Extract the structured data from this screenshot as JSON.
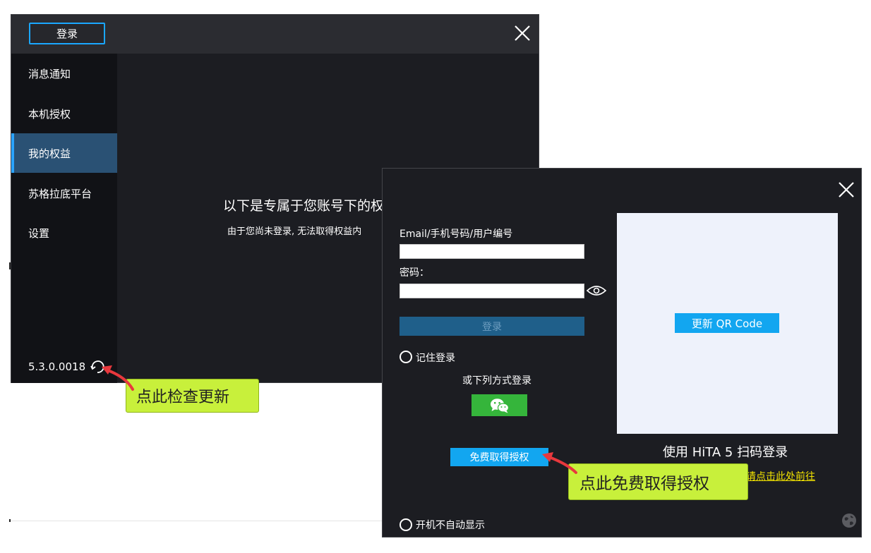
{
  "back_window": {
    "login_button": "登录",
    "sidebar": {
      "items": [
        {
          "label": "消息通知"
        },
        {
          "label": "本机授权"
        },
        {
          "label": "我的权益"
        },
        {
          "label": "苏格拉底平台"
        },
        {
          "label": "设置"
        }
      ],
      "active_index": 2,
      "version": "5.3.0.0018"
    },
    "main": {
      "title": "以下是专属于您账号下的权",
      "subtitle": "由于您尚未登录, 无法取得权益内"
    }
  },
  "login_window": {
    "email_label": "Email/手机号码/用户编号",
    "email_value": "",
    "password_label": "密码：",
    "password_value": "",
    "login_button": "登录",
    "remember_label": "记住登录",
    "alt_login_text": "或下列方式登录",
    "free_license_button": "免费取得授权",
    "qr_refresh_button": "更新 QR Code",
    "scan_text": "使用 HiTA 5 扫码登录",
    "link_text": "请点击此处前往",
    "no_autostart_label": "开机不自动显示"
  },
  "annotations": {
    "update_callout": "点此检查更新",
    "free_callout": "点此免费取得授权"
  },
  "colors": {
    "accent_blue": "#12a6f0",
    "active_sidebar": "#2a5174",
    "wechat_green": "#35b53b",
    "callout": "#c8f03b",
    "arrow_red": "#e8383d",
    "link_yellow": "#f5e500"
  }
}
